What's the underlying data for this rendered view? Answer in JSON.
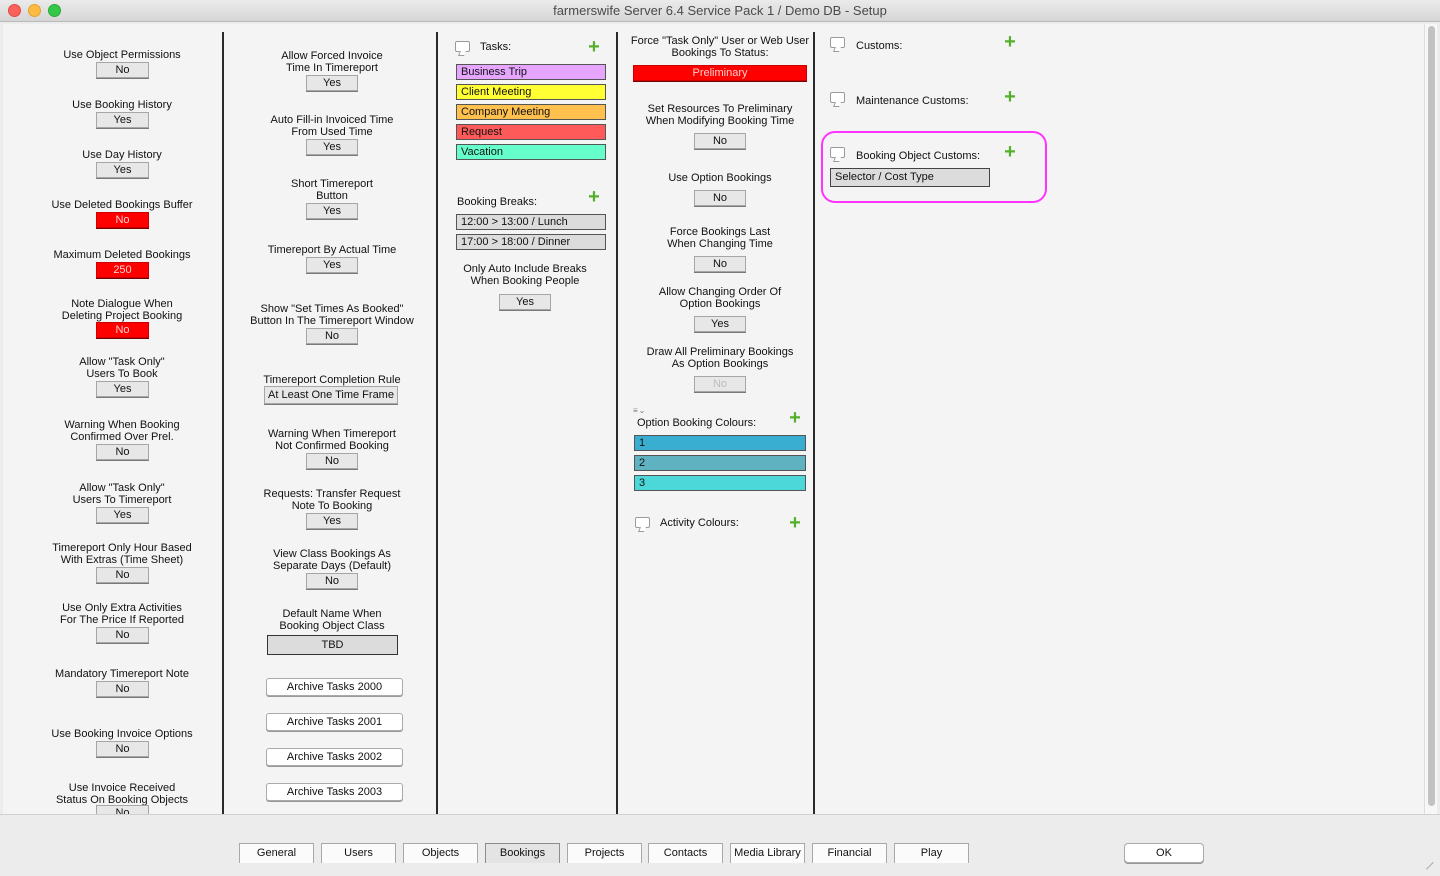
{
  "window": {
    "title": "farmerswife Server 6.4 Service Pack 1  / Demo DB - Setup"
  },
  "col1": [
    {
      "label": "Use Object Permissions",
      "value": "No"
    },
    {
      "label": "Use Booking History",
      "value": "Yes"
    },
    {
      "label": "Use Day History",
      "value": "Yes"
    },
    {
      "label": "Use Deleted Bookings Buffer",
      "value": "No"
    },
    {
      "label": "Maximum Deleted Bookings",
      "value": "250"
    },
    {
      "label": "Note Dialogue When\nDeleting Project Booking",
      "value": "No"
    },
    {
      "label": "Allow \"Task Only\"\nUsers To Book",
      "value": "Yes"
    },
    {
      "label": "Warning When Booking\nConfirmed Over Prel.",
      "value": "No"
    },
    {
      "label": "Allow \"Task Only\"\nUsers To Timereport",
      "value": "Yes"
    },
    {
      "label": "Timereport Only Hour Based\nWith Extras (Time Sheet)",
      "value": "No"
    },
    {
      "label": "Use Only Extra Activities\nFor The Price If Reported",
      "value": "No"
    },
    {
      "label": "Mandatory Timereport Note",
      "value": "No"
    },
    {
      "label": "Use Booking Invoice Options",
      "value": "No"
    },
    {
      "label": "Use Invoice Received\nStatus On Booking Objects",
      "value": "No"
    }
  ],
  "col2": [
    {
      "label": "Allow Forced Invoice\nTime In Timereport",
      "value": "Yes"
    },
    {
      "label": "Auto Fill-in Invoiced Time\nFrom Used Time",
      "value": "Yes"
    },
    {
      "label": "Short Timereport\nButton",
      "value": "Yes"
    },
    {
      "label": "Timereport By Actual Time",
      "value": "Yes"
    },
    {
      "label": "Show \"Set Times As Booked\"\nButton In The Timereport Window",
      "value": "No"
    },
    {
      "label": "Timereport Completion Rule",
      "value": "At Least One Time Frame"
    },
    {
      "label": "Warning When Timereport\nNot Confirmed Booking",
      "value": "No"
    },
    {
      "label": "Requests: Transfer Request\nNote To Booking",
      "value": "Yes"
    },
    {
      "label": "View Class Bookings As\nSeparate Days (Default)",
      "value": "No"
    },
    {
      "label": "Default Name When\nBooking Object Class",
      "value": "TBD"
    }
  ],
  "archive": [
    "Archive Tasks 2000",
    "Archive Tasks 2001",
    "Archive Tasks 2002",
    "Archive Tasks 2003"
  ],
  "tasks": {
    "label": "Tasks:",
    "items": [
      {
        "name": "Business Trip",
        "color": "#e6a6ff"
      },
      {
        "name": "Client Meeting",
        "color": "#ffff33"
      },
      {
        "name": "Company Meeting",
        "color": "#ffc04d"
      },
      {
        "name": "Request",
        "color": "#ff5a5a"
      },
      {
        "name": "Vacation",
        "color": "#66ffcc"
      }
    ]
  },
  "breaks": {
    "label": "Booking Breaks:",
    "items": [
      "12:00 > 13:00 / Lunch",
      "17:00 > 18:00 / Dinner"
    ],
    "auto_label": "Only Auto Include Breaks\nWhen Booking People",
    "auto_value": "Yes"
  },
  "col4": [
    {
      "label": "Force \"Task Only\" User or Web User\nBookings To Status:",
      "value": "Preliminary"
    },
    {
      "label": "Set Resources To Preliminary\nWhen Modifying Booking Time",
      "value": "No"
    },
    {
      "label": "Use Option Bookings",
      "value": "No"
    },
    {
      "label": "Force Bookings Last\nWhen Changing Time",
      "value": "No"
    },
    {
      "label": "Allow Changing Order Of\nOption Bookings",
      "value": "Yes"
    },
    {
      "label": "Draw All Preliminary Bookings\nAs Option Bookings",
      "value": "No"
    }
  ],
  "option_colours": {
    "label": "Option Booking Colours:",
    "items": [
      {
        "name": "1",
        "color": "#3aaed0"
      },
      {
        "name": "2",
        "color": "#5fb3c0"
      },
      {
        "name": "3",
        "color": "#4cd8d8"
      }
    ]
  },
  "activity_colours": {
    "label": "Activity Colours:"
  },
  "customs": {
    "label": "Customs:"
  },
  "maintenance_customs": {
    "label": "Maintenance Customs:"
  },
  "booking_object_customs": {
    "label": "Booking Object Customs:",
    "items": [
      "Selector / Cost Type"
    ]
  },
  "tabs": [
    "General",
    "Users",
    "Objects",
    "Bookings",
    "Projects",
    "Contacts",
    "Media Library",
    "Financial",
    "Play"
  ],
  "active_tab": "Bookings",
  "ok_label": "OK",
  "colors": {
    "red": "#ff0000",
    "plus": "#54b02b",
    "highlight": "#ff33ff"
  }
}
